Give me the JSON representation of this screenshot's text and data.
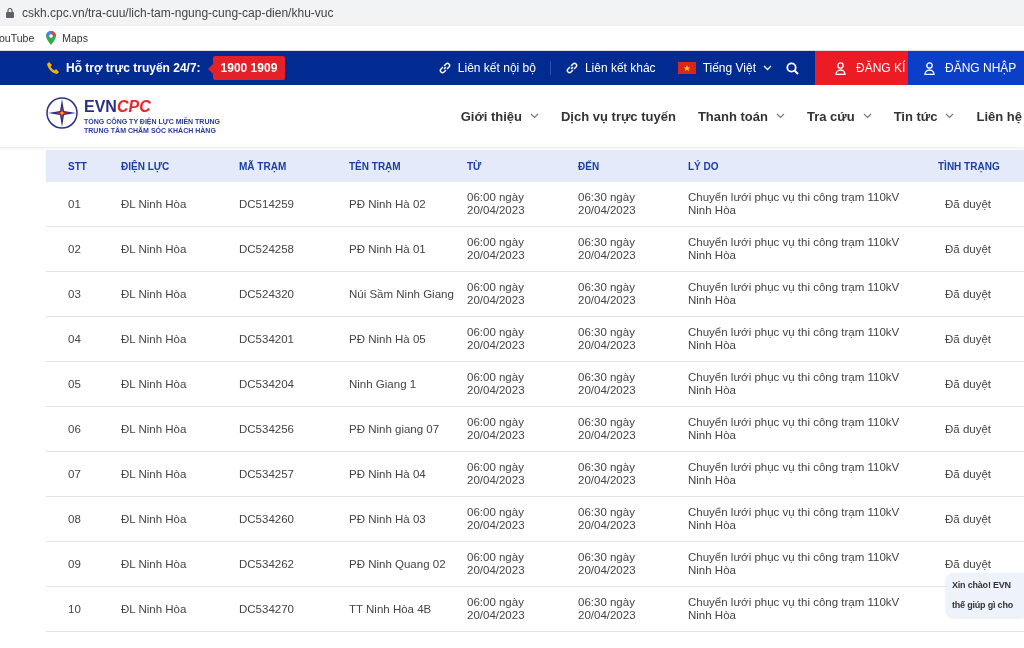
{
  "browser": {
    "url": "cskh.cpc.vn/tra-cuu/lich-tam-ngung-cung-cap-dien/khu-vuc",
    "bookmarks": [
      {
        "label": "ouTube",
        "kind": "plain"
      },
      {
        "label": "Maps",
        "kind": "maps"
      }
    ]
  },
  "topbar": {
    "support_label": "Hỗ trợ trực truyến 24/7:",
    "hotline": "1900 1909",
    "links": [
      "Liên kết nội bộ",
      "Liên kết khác"
    ],
    "language": "Tiếng Việt",
    "register": "ĐĂNG KÍ",
    "login": "ĐĂNG NHẬP"
  },
  "logo": {
    "brand_prefix": "EVN",
    "brand_suffix": "CPC",
    "line_1": "TỔNG CÔNG TY ĐIỆN LỰC MIỀN TRUNG",
    "line_2": "TRUNG TÂM CHĂM SÓC KHÁCH HÀNG"
  },
  "nav": [
    {
      "label": "Giới thiệu",
      "has_dropdown": true
    },
    {
      "label": "Dịch vụ trực tuyến",
      "has_dropdown": false
    },
    {
      "label": "Thanh toán",
      "has_dropdown": true
    },
    {
      "label": "Tra cứu",
      "has_dropdown": true
    },
    {
      "label": "Tin tức",
      "has_dropdown": true
    },
    {
      "label": "Liên hệ",
      "has_dropdown": false
    }
  ],
  "table": {
    "columns": [
      "STT",
      "ĐIỆN LỰC",
      "MÃ TRẠM",
      "TÊN TRẠM",
      "TỪ",
      "ĐẾN",
      "LÝ DO",
      "TÌNH TRẠNG"
    ],
    "rows": [
      {
        "stt": "01",
        "unit": "ĐL Ninh Hòa",
        "code": "DC514259",
        "station": "PĐ Ninh Hà 02",
        "from": "06:00 ngày 20/04/2023",
        "to": "06:30 ngày 20/04/2023",
        "reason": "Chuyển lưới phục vụ thi công trạm 110kV Ninh Hòa",
        "status": "Đã duyệt"
      },
      {
        "stt": "02",
        "unit": "ĐL Ninh Hòa",
        "code": "DC524258",
        "station": "PĐ Ninh Hà 01",
        "from": "06:00 ngày 20/04/2023",
        "to": "06:30 ngày 20/04/2023",
        "reason": "Chuyển lưới phục vụ thi công trạm 110kV Ninh Hòa",
        "status": "Đã duyệt"
      },
      {
        "stt": "03",
        "unit": "ĐL Ninh Hòa",
        "code": "DC524320",
        "station": "Núi Sầm Ninh Giang",
        "from": "06:00 ngày 20/04/2023",
        "to": "06:30 ngày 20/04/2023",
        "reason": "Chuyển lưới phục vụ thi công trạm 110kV Ninh Hòa",
        "status": "Đã duyệt"
      },
      {
        "stt": "04",
        "unit": "ĐL Ninh Hòa",
        "code": "DC534201",
        "station": "PĐ Ninh Hà 05",
        "from": "06:00 ngày 20/04/2023",
        "to": "06:30 ngày 20/04/2023",
        "reason": "Chuyển lưới phục vụ thi công trạm 110kV Ninh Hòa",
        "status": "Đã duyệt"
      },
      {
        "stt": "05",
        "unit": "ĐL Ninh Hòa",
        "code": "DC534204",
        "station": "Ninh Giang 1",
        "from": "06:00 ngày 20/04/2023",
        "to": "06:30 ngày 20/04/2023",
        "reason": "Chuyển lưới phục vụ thi công trạm 110kV Ninh Hòa",
        "status": "Đã duyệt"
      },
      {
        "stt": "06",
        "unit": "ĐL Ninh Hòa",
        "code": "DC534256",
        "station": "PĐ Ninh giang 07",
        "from": "06:00 ngày 20/04/2023",
        "to": "06:30 ngày 20/04/2023",
        "reason": "Chuyển lưới phục vụ thi công trạm 110kV Ninh Hòa",
        "status": "Đã duyệt"
      },
      {
        "stt": "07",
        "unit": "ĐL Ninh Hòa",
        "code": "DC534257",
        "station": "PĐ Ninh Hà 04",
        "from": "06:00 ngày 20/04/2023",
        "to": "06:30 ngày 20/04/2023",
        "reason": "Chuyển lưới phục vụ thi công trạm 110kV Ninh Hòa",
        "status": "Đã duyệt"
      },
      {
        "stt": "08",
        "unit": "ĐL Ninh Hòa",
        "code": "DC534260",
        "station": "PĐ Ninh Hà 03",
        "from": "06:00 ngày 20/04/2023",
        "to": "06:30 ngày 20/04/2023",
        "reason": "Chuyển lưới phục vụ thi công trạm 110kV Ninh Hòa",
        "status": "Đã duyệt"
      },
      {
        "stt": "09",
        "unit": "ĐL Ninh Hòa",
        "code": "DC534262",
        "station": "PĐ Ninh Quang 02",
        "from": "06:00 ngày 20/04/2023",
        "to": "06:30 ngày 20/04/2023",
        "reason": "Chuyển lưới phục vụ thi công trạm 110kV Ninh Hòa",
        "status": "Đã duyệt"
      },
      {
        "stt": "10",
        "unit": "ĐL Ninh Hòa",
        "code": "DC534270",
        "station": "TT Ninh Hòa 4B",
        "from": "06:00 ngày 20/04/2023",
        "to": "06:30 ngày 20/04/2023",
        "reason": "Chuyển lưới phục vụ thi công trạm 110kV Ninh Hòa"
      }
    ]
  },
  "chat": {
    "lines": [
      "Xin chào! EVN",
      "thế giúp gì cho"
    ]
  }
}
